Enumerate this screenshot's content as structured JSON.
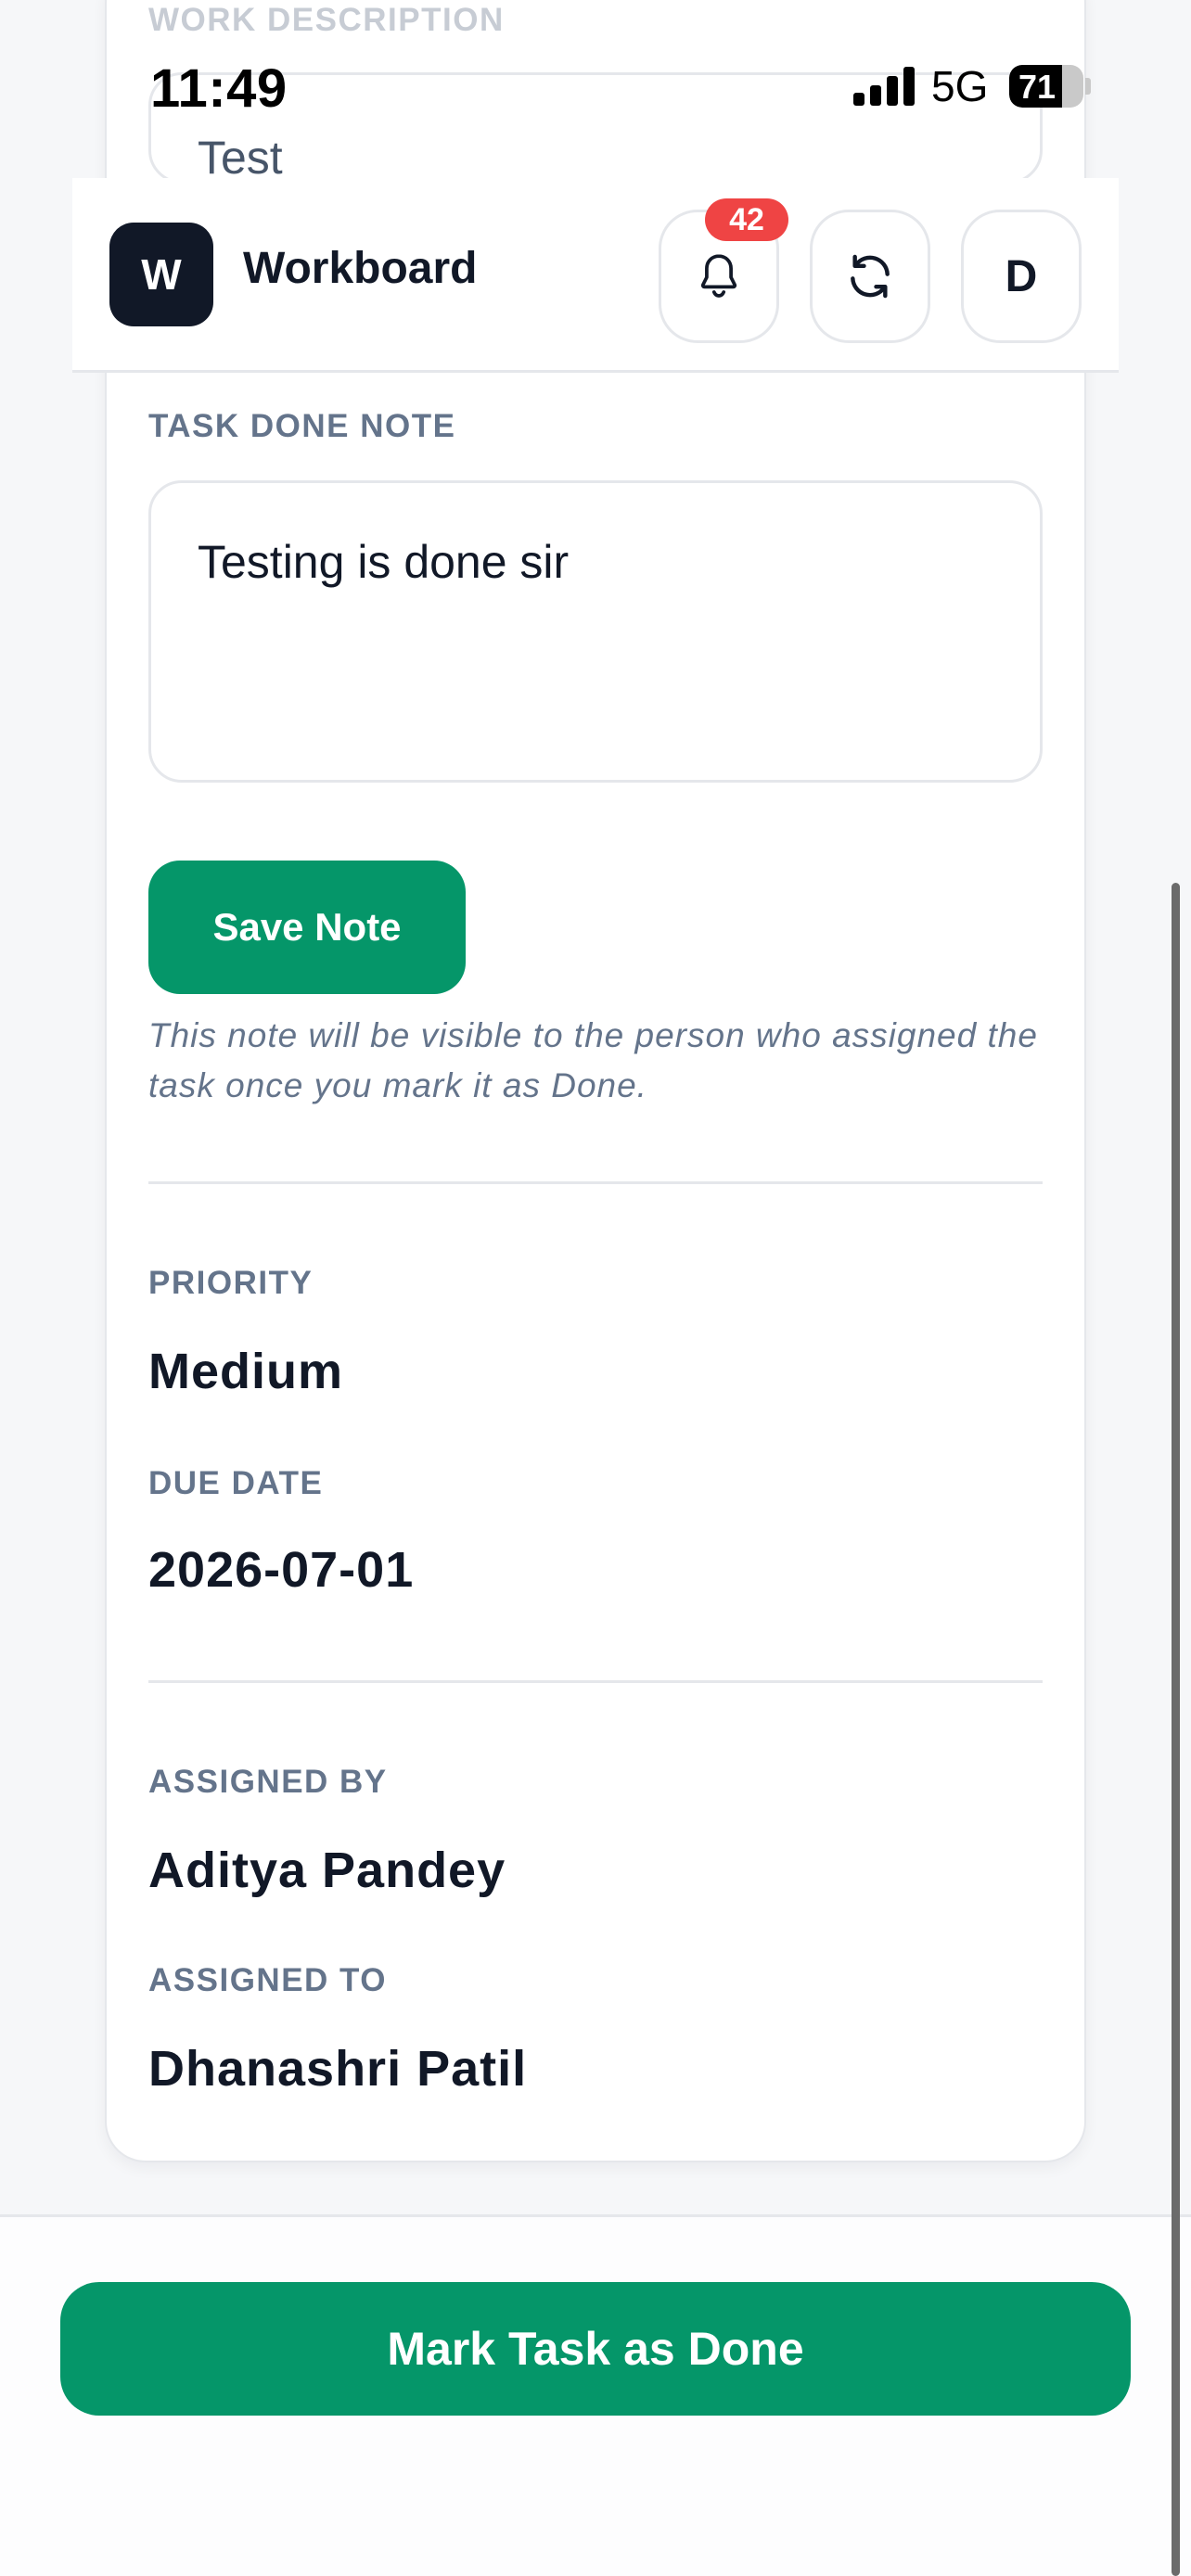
{
  "status_bar": {
    "time": "11:49",
    "network": "5G",
    "battery": "71",
    "battery_level": 0.71
  },
  "header": {
    "logo_letter": "W",
    "title": "Workboard",
    "notification_count": "42",
    "avatar_letter": "D"
  },
  "work_description": {
    "label": "WORK DESCRIPTION",
    "value": "Test"
  },
  "task_done_note": {
    "label": "TASK DONE NOTE",
    "value": "Testing is done sir",
    "save_label": "Save Note",
    "hint": "This note will be visible to the person who assigned the task once you mark it as Done."
  },
  "details": {
    "priority_label": "PRIORITY",
    "priority": "Medium",
    "due_date_label": "DUE DATE",
    "due_date": "2026-07-01",
    "assigned_by_label": "ASSIGNED BY",
    "assigned_by": "Aditya Pandey",
    "assigned_to_label": "ASSIGNED TO",
    "assigned_to": "Dhanashri Patil"
  },
  "actions": {
    "mark_done_label": "Mark Task as Done"
  },
  "icons": {
    "notifications": "bell-icon",
    "refresh": "refresh-icon"
  },
  "colors": {
    "accent": "#059669",
    "badge": "#ef4444",
    "logo_bg": "#111827",
    "label": "#64748b"
  }
}
